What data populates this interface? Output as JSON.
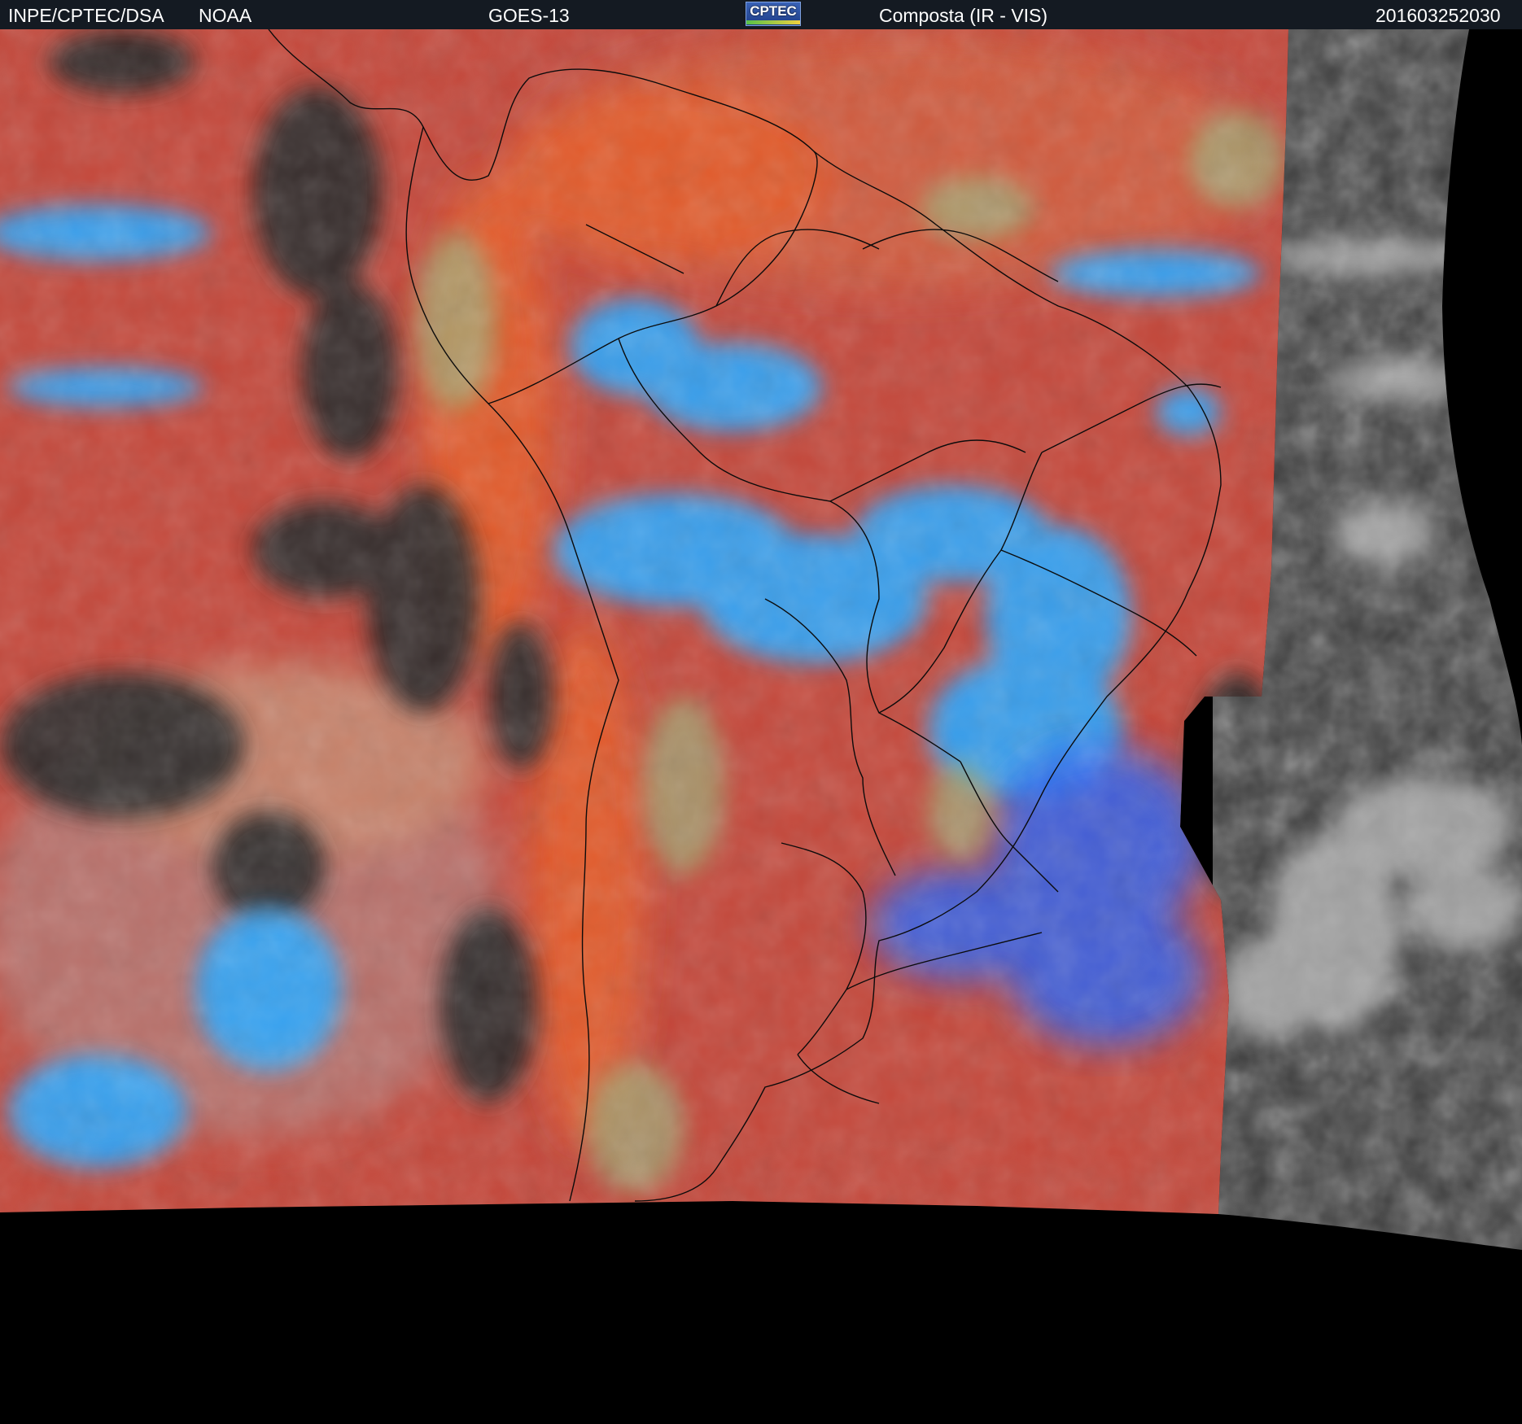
{
  "header": {
    "agency": "INPE/CPTEC/DSA",
    "partner": "NOAA",
    "satellite": "GOES-13",
    "logo_text": "CPTEC",
    "product": "Composta (IR - VIS)",
    "timestamp": "201603252030",
    "background_color": "#141a22"
  },
  "map": {
    "region": "South America",
    "colors": {
      "warm_surface": "#c4473a",
      "orange_coast": "#e25a2a",
      "cold_cloud_tops": "#2aa8ff",
      "mid_cloud": "#9fb07a",
      "clear_ocean": "#2a2a2a",
      "vis_only_region": "#4a4a4a",
      "no_data": "#000000",
      "borders": "#0a0a0a"
    }
  }
}
